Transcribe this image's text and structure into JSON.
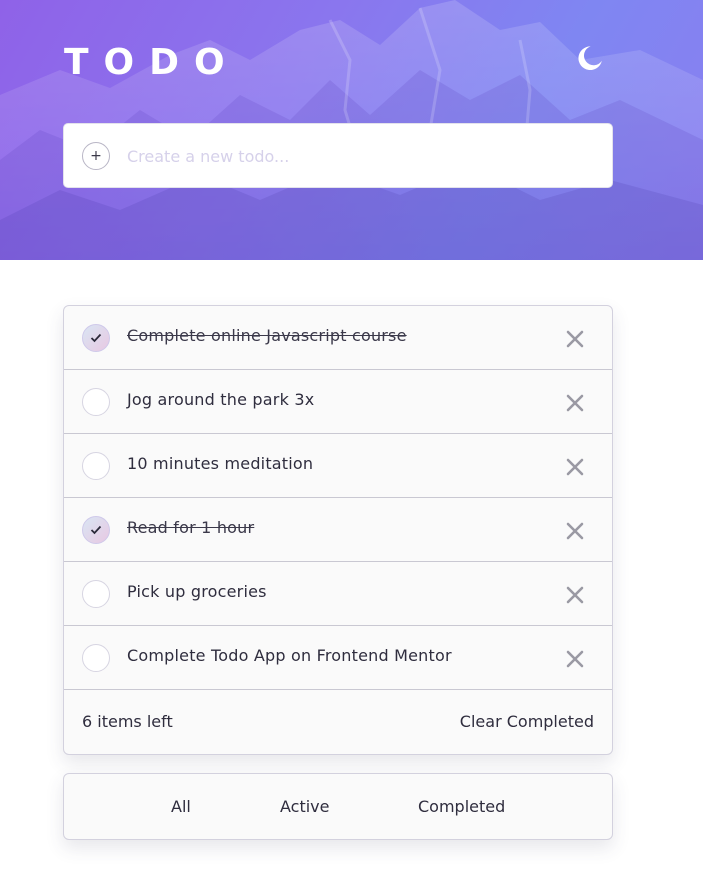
{
  "app": {
    "title": "TODO"
  },
  "header": {
    "theme_icon": "moon-icon"
  },
  "new_todo": {
    "placeholder": "Create a new todo...",
    "add_icon_glyph": "+"
  },
  "todos": [
    {
      "text": "Complete online Javascript course",
      "completed": true
    },
    {
      "text": "Jog around the park 3x",
      "completed": false
    },
    {
      "text": "10 minutes meditation",
      "completed": false
    },
    {
      "text": "Read for 1 hour",
      "completed": true
    },
    {
      "text": "Pick up groceries",
      "completed": false
    },
    {
      "text": "Complete Todo App on Frontend Mentor",
      "completed": false
    }
  ],
  "footer": {
    "items_left": "6 items left",
    "clear_completed": "Clear Completed"
  },
  "filters": {
    "all": "All",
    "active": "Active",
    "completed": "Completed"
  },
  "colors": {
    "header_gradient_start": "#8f62e8",
    "header_gradient_end": "#7f86f2",
    "check_gradient_start": "#d9e6f4",
    "check_gradient_end": "#e8c8e2"
  }
}
